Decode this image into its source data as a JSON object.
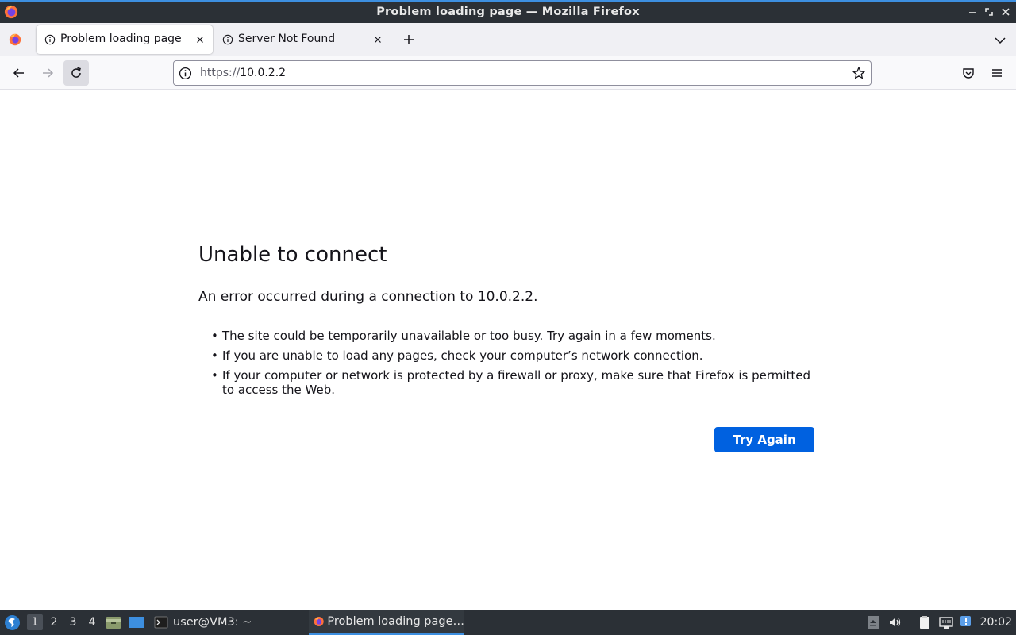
{
  "window": {
    "title": "Problem loading page — Mozilla Firefox"
  },
  "tabs": [
    {
      "label": "Problem loading page",
      "active": true
    },
    {
      "label": "Server Not Found",
      "active": false
    }
  ],
  "urlbar": {
    "scheme": "https://",
    "host": "10.0.2.2"
  },
  "error": {
    "title": "Unable to connect",
    "description": "An error occurred during a connection to 10.0.2.2.",
    "reasons": [
      "The site could be temporarily unavailable or too busy. Try again in a few moments.",
      "If you are unable to load any pages, check your computer’s network connection.",
      "If your computer or network is protected by a firewall or proxy, make sure that Firefox is permitted to access the Web."
    ],
    "try_again_label": "Try Again"
  },
  "taskbar": {
    "workspaces": [
      "1",
      "2",
      "3",
      "4"
    ],
    "active_workspace": "1",
    "tasks": [
      {
        "label": "user@VM3: ~",
        "icon": "terminal-icon"
      },
      {
        "label": "Problem loading page…",
        "icon": "firefox-icon"
      }
    ],
    "clock": "20:02"
  },
  "colors": {
    "accent": "#0061e0",
    "titlebar": "#2b3036",
    "taskbar_highlight": "#3d8fe0"
  }
}
